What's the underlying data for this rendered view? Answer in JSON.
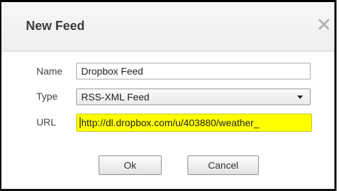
{
  "dialog": {
    "title": "New Feed",
    "close_icon": "close-icon"
  },
  "form": {
    "name": {
      "label": "Name",
      "value": "Dropbox Feed"
    },
    "type": {
      "label": "Type",
      "value": "RSS-XML Feed",
      "icon": "chevron-down-icon"
    },
    "url": {
      "label": "URL",
      "value": "http://dl.dropbox.com/u/403880/weather_",
      "highlight_color": "#ffff00"
    }
  },
  "buttons": {
    "ok_label": "Ok",
    "cancel_label": "Cancel"
  }
}
